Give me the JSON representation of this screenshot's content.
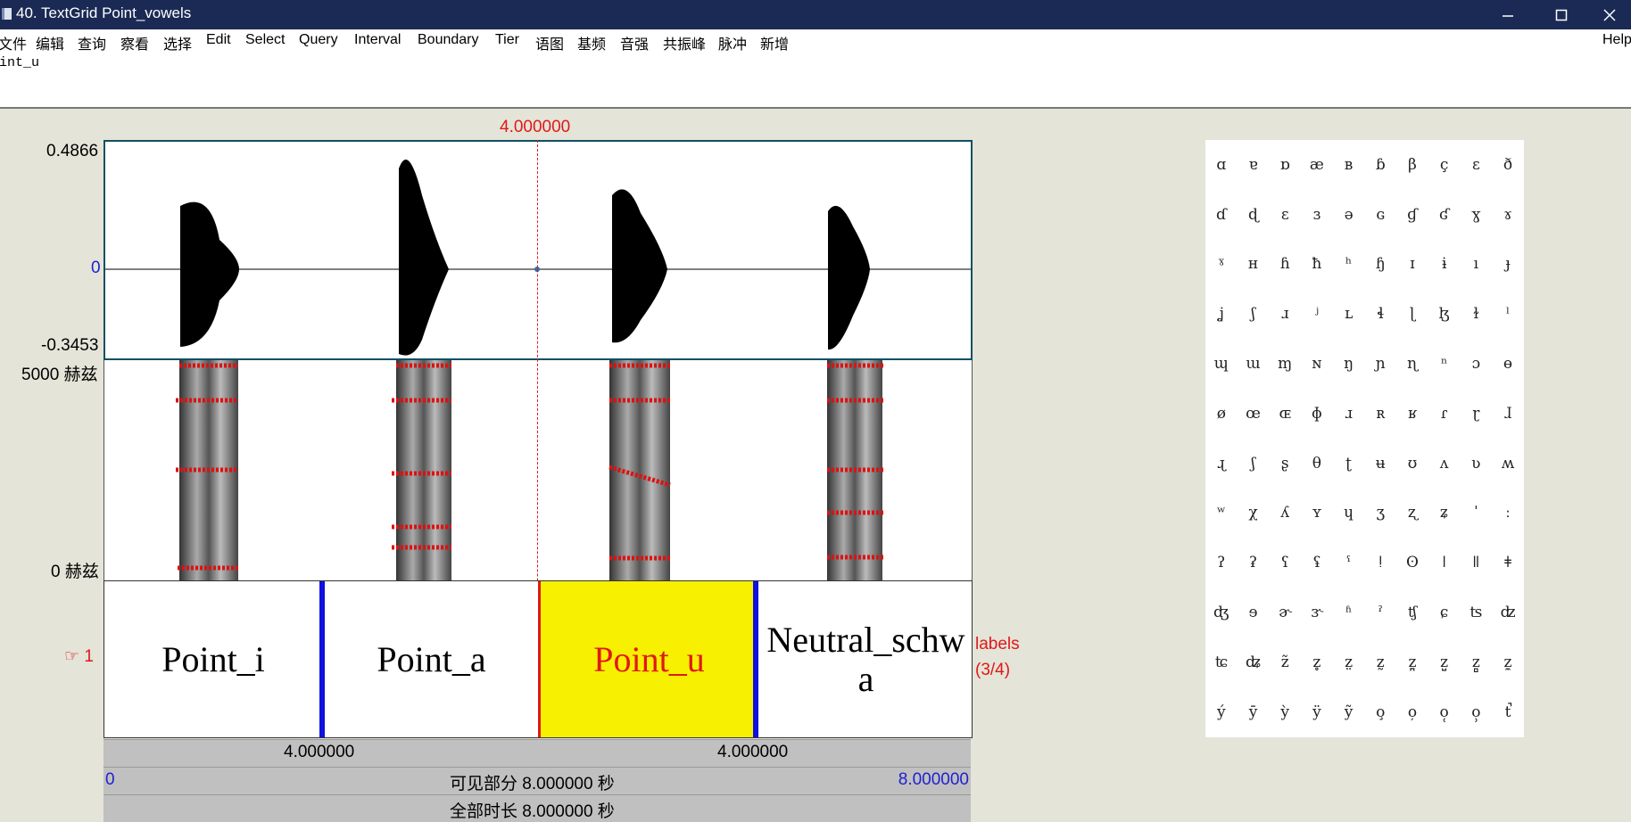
{
  "window": {
    "title": "40. TextGrid Point_vowels"
  },
  "menu": {
    "items": [
      "文件",
      "编辑",
      "查询",
      "察看",
      "选择",
      "Edit",
      "Select",
      "Query",
      "Interval",
      "Boundary",
      "Tier",
      "语图",
      "基频",
      "音强",
      "共振峰",
      "脉冲",
      "新增"
    ],
    "help": "Help"
  },
  "text_area": {
    "value": "oint_u"
  },
  "cursor": {
    "time_label": "4.000000"
  },
  "waveform": {
    "max_label": "0.4866",
    "zero_label": "0",
    "min_label": "-0.3453"
  },
  "spectrogram": {
    "top_label": "5000 赫兹",
    "bottom_label": "0 赫兹"
  },
  "tier": {
    "number": "1",
    "name": "labels",
    "count": "(3/4)",
    "intervals": [
      {
        "label": "Point_i"
      },
      {
        "label": "Point_a"
      },
      {
        "label": "Point_u",
        "selected": true
      },
      {
        "label": "Neutral_schwa"
      }
    ]
  },
  "time_rows": {
    "row1": {
      "left": "4.000000",
      "right": "4.000000"
    },
    "row2": {
      "start": "0",
      "visible": "可见部分 8.000000 秒",
      "end": "8.000000"
    },
    "row3": {
      "total": "全部时长 8.000000 秒"
    }
  },
  "ipa_chars": [
    "ɑ",
    "ɐ",
    "ɒ",
    "æ",
    "ʙ",
    "ɓ",
    "β",
    "ç",
    "ɛ",
    "ð",
    "ɗ",
    "ɖ",
    "ɛ",
    "ɜ",
    "ə",
    "ɢ",
    "ɠ",
    "ʛ",
    "ɣ",
    "ɤ",
    "ˠ",
    "ʜ",
    "ɦ",
    "ħ",
    "ʰ",
    "ɧ",
    "ɪ",
    "ɨ",
    "ı",
    "ɟ",
    "ʝ",
    "ʃ",
    "ɹ",
    "ʲ",
    "ʟ",
    "ɬ",
    "ɭ",
    "ɮ",
    "ɫ",
    "ˡ",
    "ɰ",
    "ɯ",
    "ɱ",
    "ɴ",
    "ŋ",
    "ɲ",
    "ɳ",
    "ⁿ",
    "ɔ",
    "ɵ",
    "ø",
    "œ",
    "ɶ",
    "ɸ",
    "ɹ",
    "ʀ",
    "ʁ",
    "ɾ",
    "ɽ",
    "ɺ",
    "ɻ",
    "ʃ",
    "ʂ",
    "θ",
    "ʈ",
    "ʉ",
    "ʊ",
    "ʌ",
    "ʋ",
    "ʍ",
    "ʷ",
    "χ",
    "ʎ",
    "ʏ",
    "ɥ",
    "ʒ",
    "ʐ",
    "ʑ",
    "ˈ",
    "ː",
    "ʔ",
    "ʡ",
    "ʕ",
    "ʢ",
    "ˤ",
    "ǃ",
    "ʘ",
    "ǀ",
    "ǁ",
    "ǂ",
    "ʤ",
    "ɘ",
    "ɚ",
    "ɝ",
    "ʱ",
    "ˀ",
    "ʧ",
    "ɕ",
    "ʦ",
    "ʣ",
    "ʨ",
    "ʥ",
    "z̃",
    "z̥",
    "z̤",
    "z̰",
    "z̪",
    "z̺",
    "z̻",
    "z̼",
    "ý",
    "ȳ",
    "ỳ",
    "ÿ",
    "ỹ",
    "o̧",
    "o̦",
    "o̜",
    "o̹",
    "t̚"
  ]
}
